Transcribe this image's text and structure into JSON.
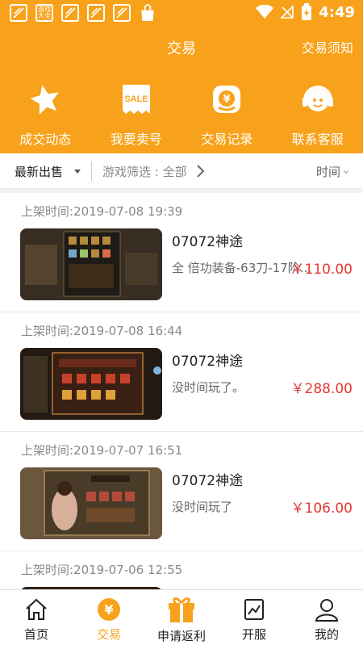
{
  "status_bar": {
    "time": "4:49",
    "left_icons": [
      "feather-icon",
      "game-box-icon",
      "feather-icon",
      "feather-icon",
      "feather-icon",
      "bag-icon"
    ],
    "game_box_text": "游戏\n大全"
  },
  "nav": {
    "title": "交易",
    "notice": "交易须知"
  },
  "quick_actions": [
    {
      "label": "成交动态",
      "icon": "star-icon"
    },
    {
      "label": "我要卖号",
      "icon": "sale-icon"
    },
    {
      "label": "交易记录",
      "icon": "yen-icon"
    },
    {
      "label": "联系客服",
      "icon": "headset-icon"
    }
  ],
  "filter": {
    "sort_label": "最新出售",
    "game_filter": "游戏筛选 : 全部",
    "time_label": "时间"
  },
  "listings": [
    {
      "time": "上架时间:2019-07-08 19:39",
      "title": "07072神途",
      "desc": "全 倍功装备-63刀-17阶...",
      "price": "￥110.00"
    },
    {
      "time": "上架时间:2019-07-08 16:44",
      "title": "07072神途",
      "desc": "没时间玩了。",
      "price": "￥288.00"
    },
    {
      "time": "上架时间:2019-07-07 16:51",
      "title": "07072神途",
      "desc": "没时间玩了",
      "price": "￥106.00"
    },
    {
      "time": "上架时间:2019-07-06 12:55",
      "title": "",
      "desc": "",
      "price": ""
    }
  ],
  "tabbar": [
    {
      "label": "首页",
      "icon": "home-icon",
      "active": false
    },
    {
      "label": "交易",
      "icon": "yen-coin-icon",
      "active": true
    },
    {
      "label": "申请返利",
      "icon": "gift-icon",
      "active": false
    },
    {
      "label": "开服",
      "icon": "chart-icon",
      "active": false
    },
    {
      "label": "我的",
      "icon": "user-icon",
      "active": false
    }
  ],
  "colors": {
    "brand": "#f8a21b",
    "price": "#e8352e"
  }
}
